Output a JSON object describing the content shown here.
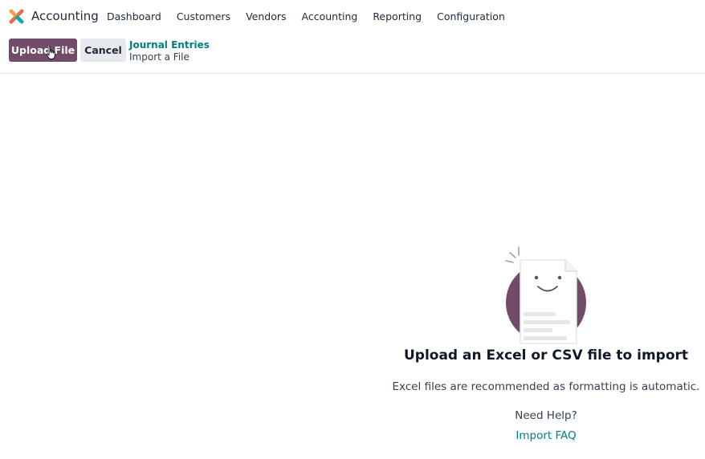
{
  "navbar": {
    "app_name": "Accounting",
    "logo_icon": "odoo-app-logo-icon",
    "menu": [
      {
        "label": "Dashboard"
      },
      {
        "label": "Customers"
      },
      {
        "label": "Vendors"
      },
      {
        "label": "Accounting"
      },
      {
        "label": "Reporting"
      },
      {
        "label": "Configuration"
      }
    ]
  },
  "control_panel": {
    "upload_label": "Upload File",
    "cancel_label": "Cancel",
    "breadcrumb_parent": "Journal Entries",
    "breadcrumb_current": "Import a File"
  },
  "empty_state": {
    "illustration_icon": "smiling-document-icon",
    "title": "Upload an Excel or CSV file to import",
    "description": "Excel files are recommended as formatting is automatic.",
    "help_label": "Need Help?",
    "faq_link": "Import FAQ"
  },
  "colors": {
    "primary": "#714b67",
    "link": "#017e84",
    "secondary_button": "#e7e9ed"
  }
}
